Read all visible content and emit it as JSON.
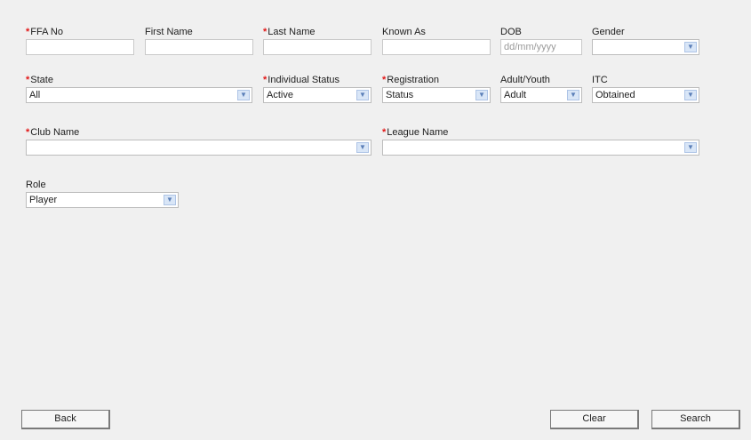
{
  "form": {
    "ffa_no": {
      "label": "FFA No",
      "value": ""
    },
    "first_name": {
      "label": "First Name",
      "value": ""
    },
    "last_name": {
      "label": "Last Name",
      "value": ""
    },
    "known_as": {
      "label": "Known As",
      "value": ""
    },
    "dob": {
      "label": "DOB",
      "placeholder": "dd/mm/yyyy"
    },
    "gender": {
      "label": "Gender",
      "value": ""
    },
    "state": {
      "label": "State",
      "value": "All"
    },
    "individual_status": {
      "label": "Individual Status",
      "value": "Active"
    },
    "registration": {
      "label": "Registration",
      "value": "Status"
    },
    "adult_youth": {
      "label": "Adult/Youth",
      "value": "Adult"
    },
    "itc": {
      "label": "ITC",
      "value": "Obtained"
    },
    "club_name": {
      "label": "Club Name",
      "value": ""
    },
    "league_name": {
      "label": "League Name",
      "value": ""
    },
    "role": {
      "label": "Role",
      "value": "Player"
    }
  },
  "buttons": {
    "back": "Back",
    "clear": "Clear",
    "search": "Search"
  },
  "required_marker": "*",
  "colors": {
    "required": "#e21818",
    "panel": "#f0f0f0",
    "dropdown_arrow": "#d9e6f7"
  },
  "icons": {
    "dropdown": "chevron-down-icon"
  }
}
